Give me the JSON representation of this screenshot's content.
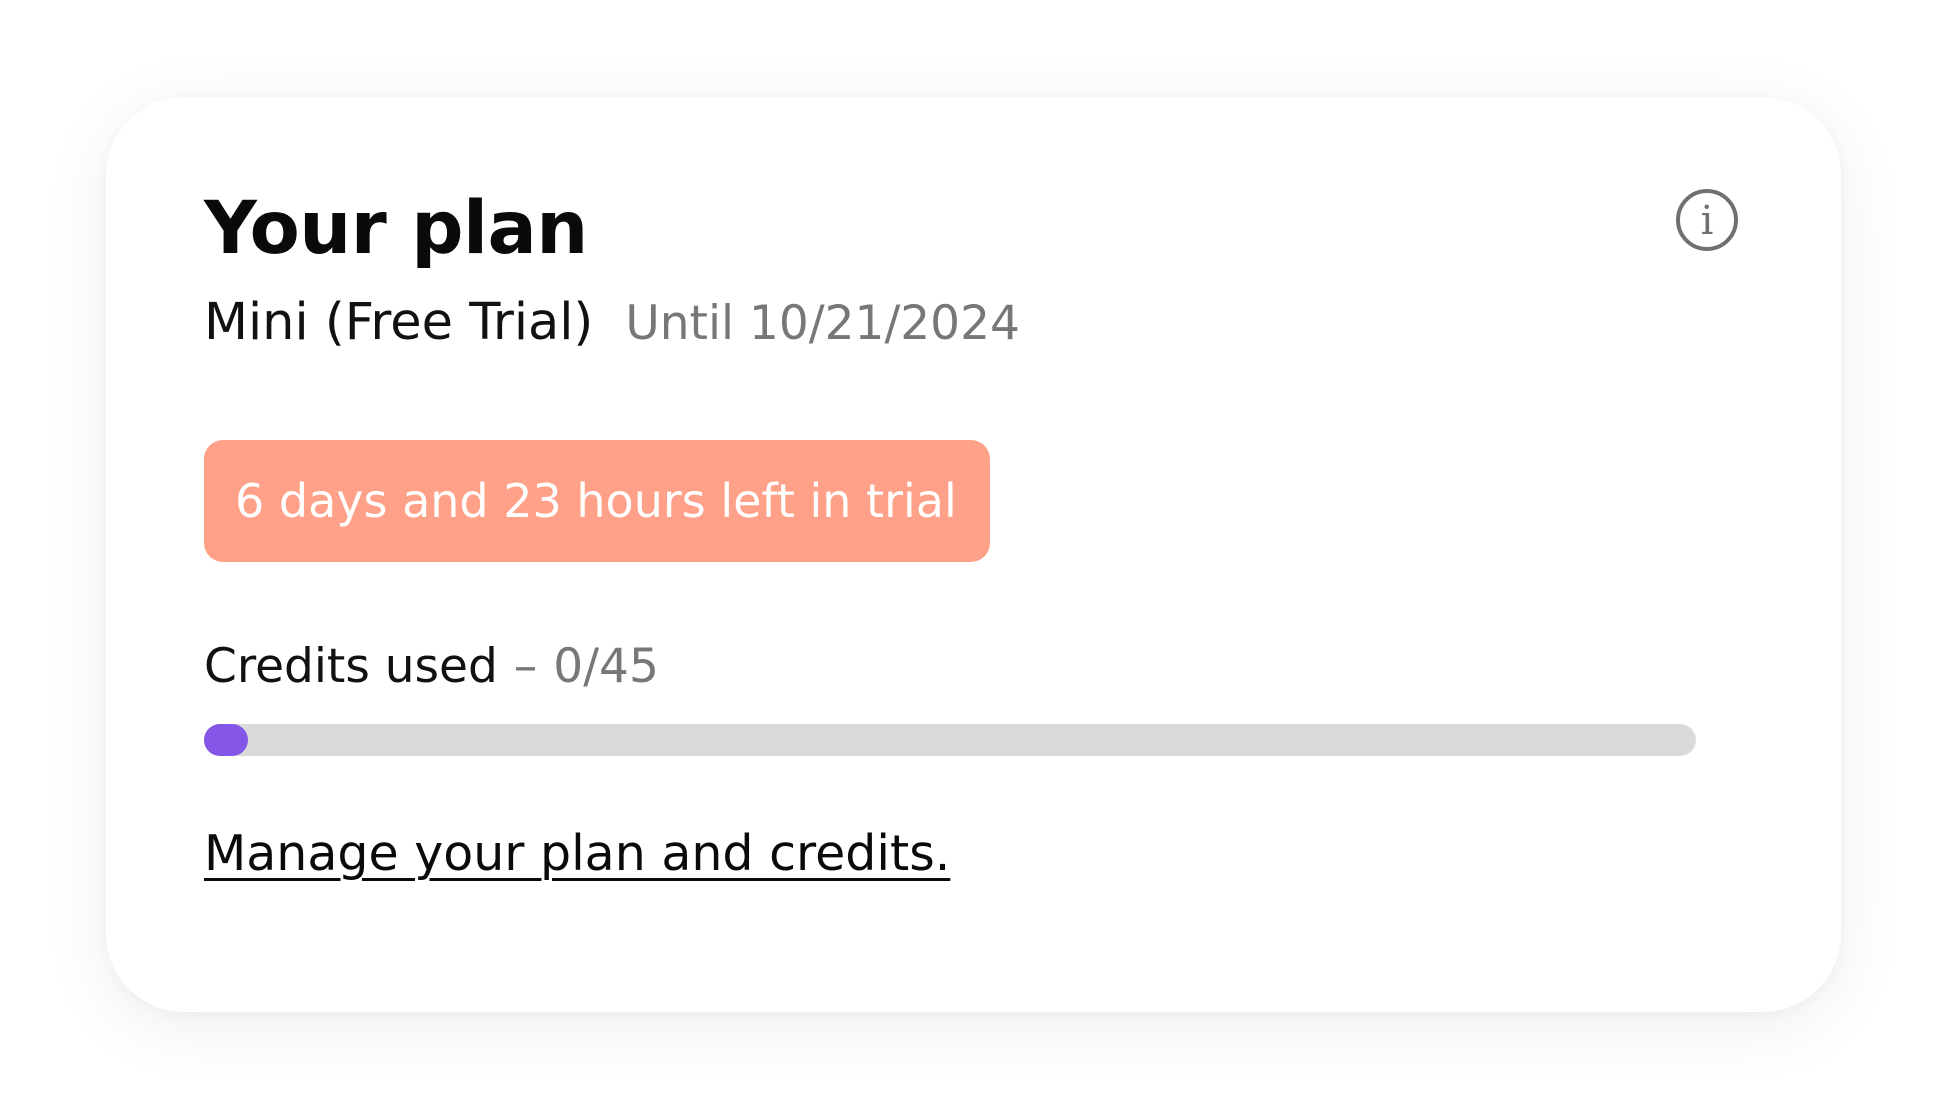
{
  "plan_card": {
    "title": "Your plan",
    "info_icon": "info-circle-icon",
    "info_glyph": "i",
    "plan_name": "Mini (Free Trial)",
    "plan_until": "Until 10/21/2024",
    "trial_remaining": "6 days and 23 hours left in trial",
    "credits": {
      "label": "Credits used",
      "separator": "–",
      "value": "0/45",
      "used": 0,
      "total": 45
    },
    "manage_link": "Manage your plan and credits."
  },
  "colors": {
    "trial_badge_bg": "#ffa088",
    "progress_fill": "#8356e8",
    "progress_track": "#dadada",
    "muted_text": "#777777"
  }
}
